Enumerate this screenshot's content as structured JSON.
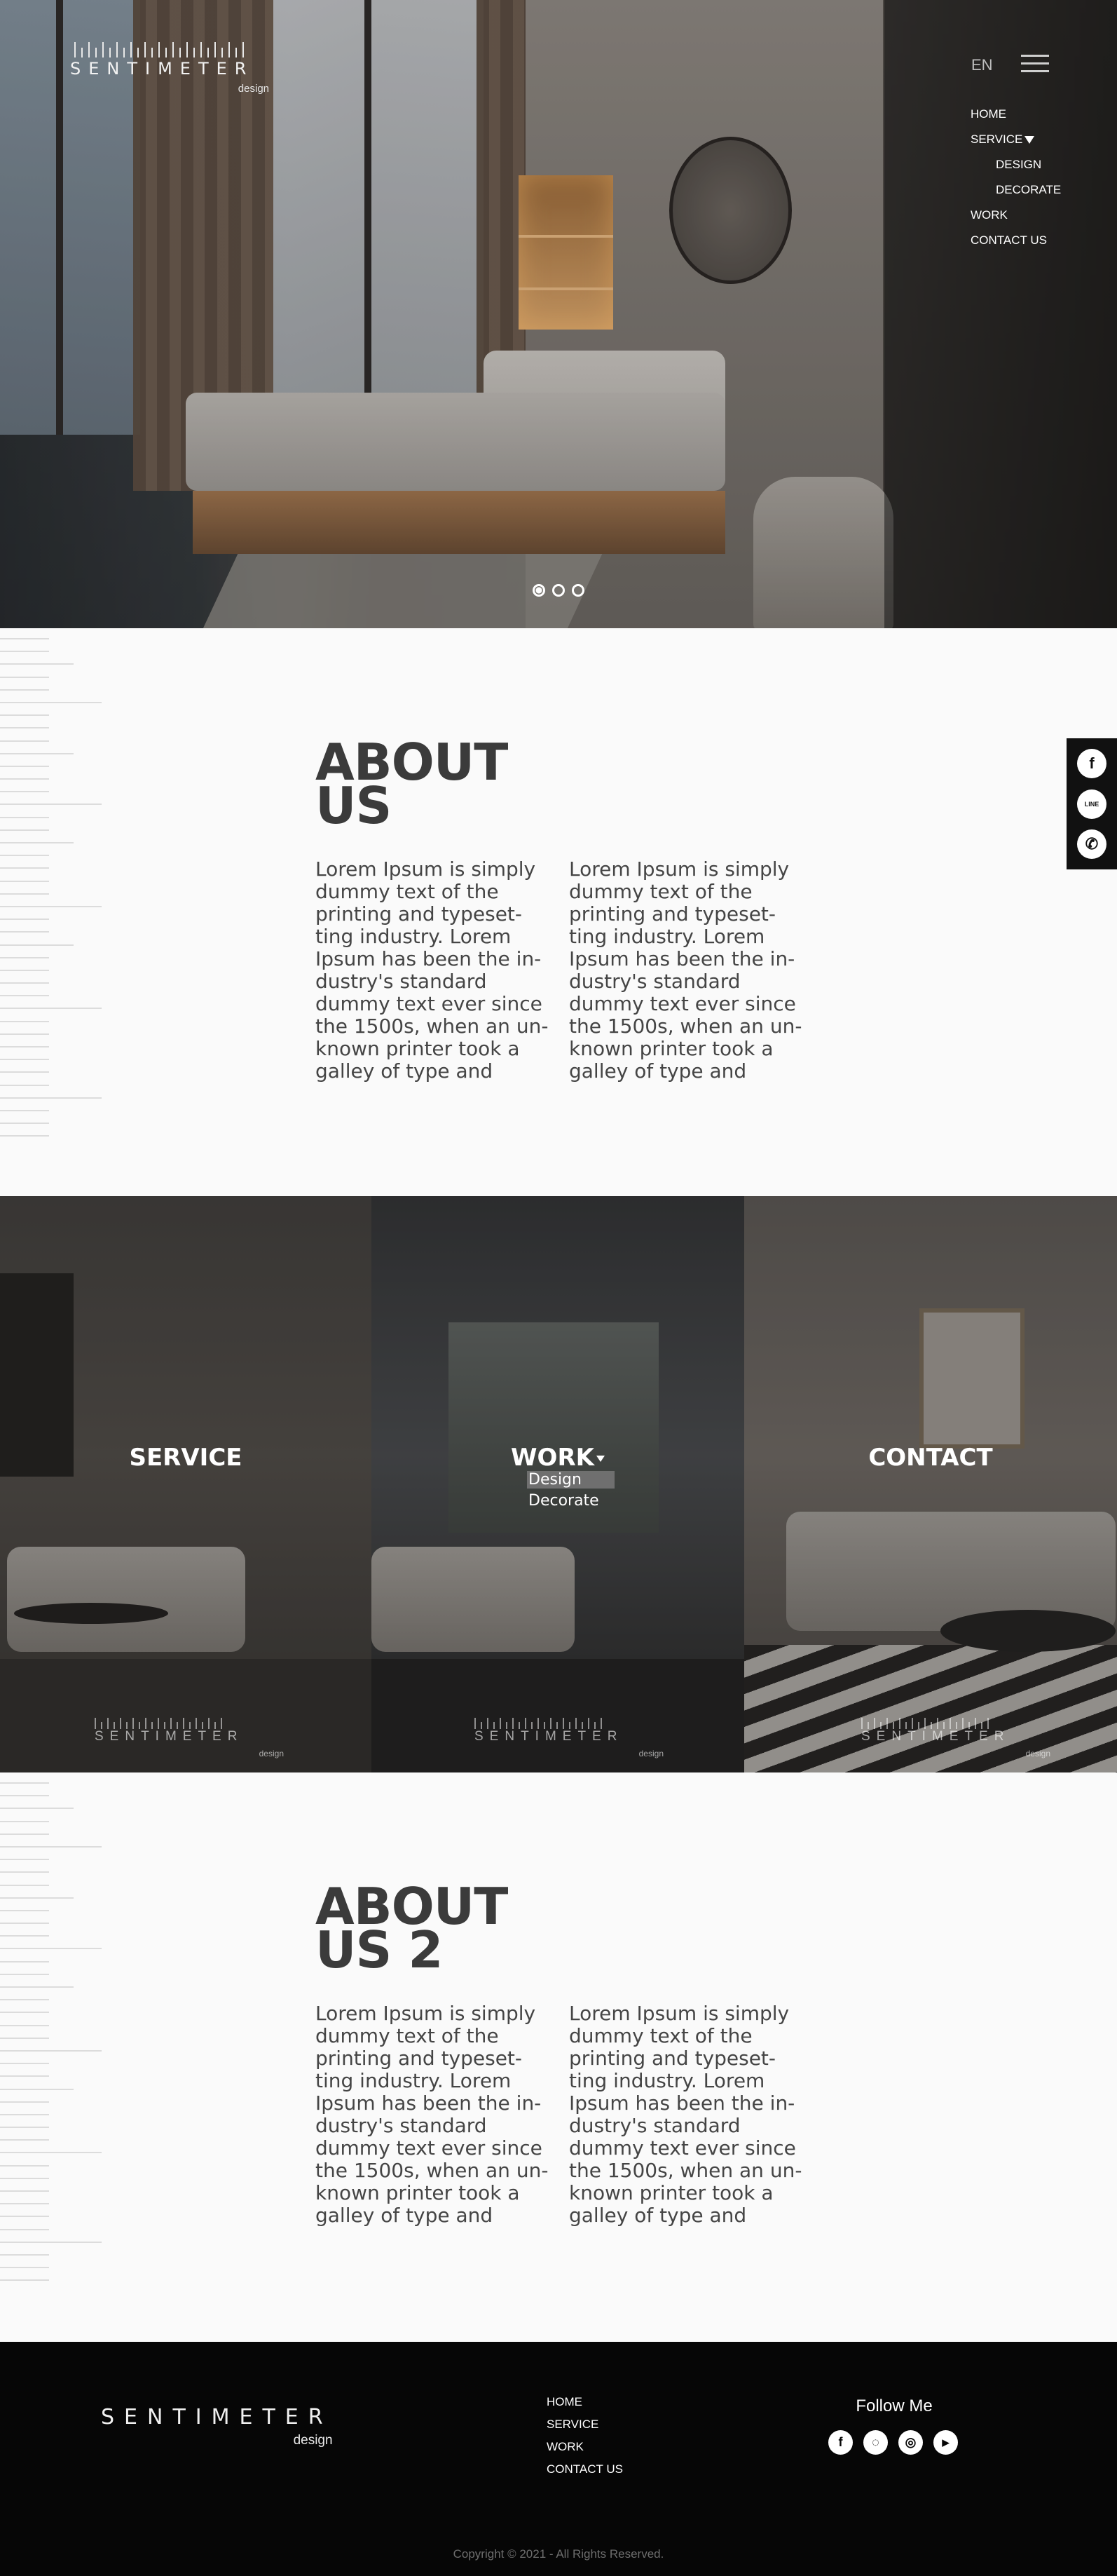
{
  "brand": {
    "name": "SENTIMETER",
    "sub": "design"
  },
  "header": {
    "lang": "EN",
    "menu": [
      {
        "label": "HOME"
      },
      {
        "label": "SERVICE"
      },
      {
        "label": "DESIGN"
      },
      {
        "label": "DECORATE"
      },
      {
        "label": "WORK"
      },
      {
        "label": "CONTACT US"
      }
    ]
  },
  "about1": {
    "title_line1": "ABOUT",
    "title_line2": "US",
    "col1": "Lorem Ipsum is simply\ndummy text of the\nprinting and typeset-\nting industry. Lorem\nIpsum has been the in-\ndustry's standard\ndummy text ever since\nthe 1500s, when an un-\nknown printer took a\ngalley of type and",
    "col2": "Lorem Ipsum is simply\ndummy text of the\nprinting and typeset-\nting industry. Lorem\nIpsum has been the in-\ndustry's standard\ndummy text ever since\nthe 1500s, when an un-\nknown printer took a\ngalley of type and"
  },
  "social": [
    {
      "icon": "facebook-icon",
      "glyph": "f"
    },
    {
      "icon": "line-icon",
      "glyph": "LINE"
    },
    {
      "icon": "phone-icon",
      "glyph": "✆"
    }
  ],
  "panels": {
    "service": "SERVICE",
    "work": "WORK",
    "work_items": [
      "Design",
      "Decorate"
    ],
    "contact": "CONTACT"
  },
  "about2": {
    "title_line1": "ABOUT",
    "title_line2": "US 2",
    "col1": "Lorem Ipsum is simply\ndummy text of the\nprinting and typeset-\nting industry. Lorem\nIpsum has been the in-\ndustry's standard\ndummy text ever since\nthe 1500s, when an un-\nknown printer took a\ngalley of type and",
    "col2": "Lorem Ipsum is simply\ndummy text of the\nprinting and typeset-\nting industry. Lorem\nIpsum has been the in-\ndustry's standard\ndummy text ever since\nthe 1500s, when an un-\nknown printer took a\ngalley of type and"
  },
  "footer": {
    "menu": [
      "HOME",
      "SERVICE",
      "WORK",
      "CONTACT US"
    ],
    "follow": "Follow Me",
    "icons": [
      {
        "icon": "facebook-icon",
        "glyph": "f"
      },
      {
        "icon": "line-icon",
        "glyph": "◌"
      },
      {
        "icon": "instagram-icon",
        "glyph": "◎"
      },
      {
        "icon": "youtube-icon",
        "glyph": "▶"
      }
    ],
    "copyright": "Copyright © 2021 - All Rights Reserved."
  },
  "colors": {
    "accent": "#ffffff",
    "dark": "#060606",
    "text": "#3a3a3a",
    "background": "#fafafa"
  }
}
